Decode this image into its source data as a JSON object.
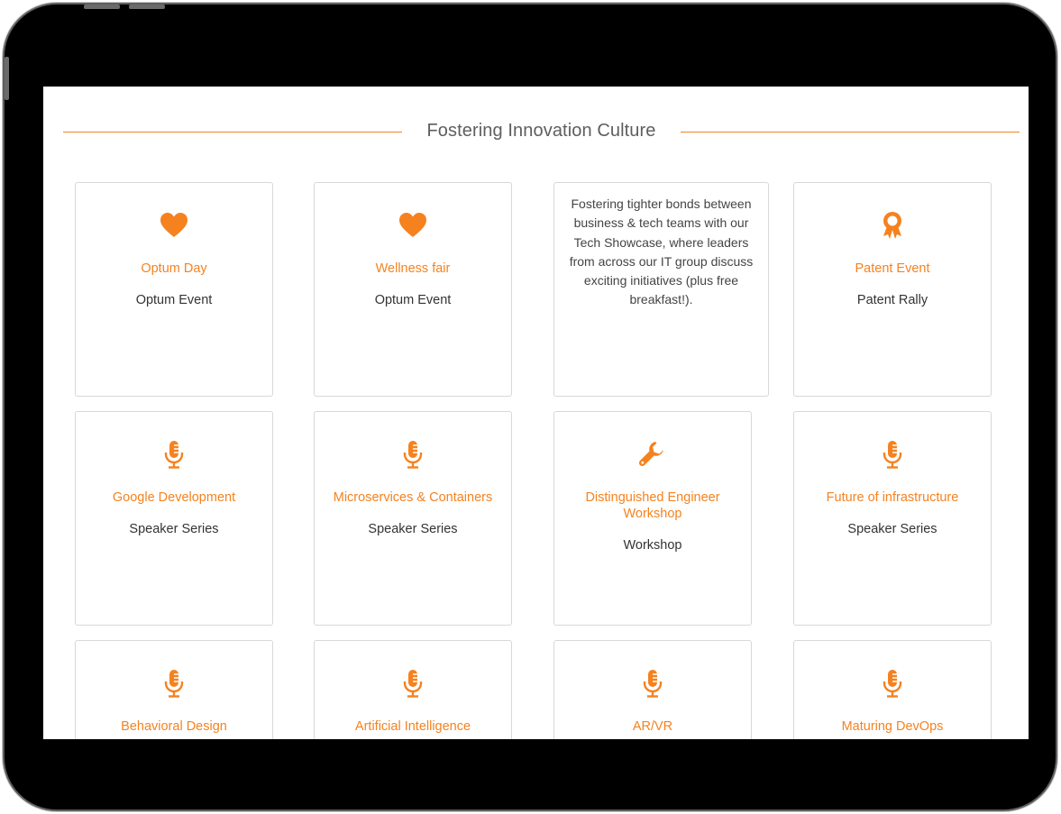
{
  "section": {
    "title": "Fostering Innovation Culture"
  },
  "accent_color": "#f5821f",
  "cards": [
    {
      "icon": "heart-icon",
      "title": "Optum Day",
      "subtitle": "Optum Event"
    },
    {
      "icon": "heart-icon",
      "title": "Wellness fair",
      "subtitle": "Optum Event"
    },
    {
      "description": "Fostering tighter bonds between business & tech teams with our Tech Showcase, where leaders from across our IT group discuss exciting initiatives (plus free breakfast!)."
    },
    {
      "icon": "award-icon",
      "title": "Patent Event",
      "subtitle": "Patent Rally"
    },
    {
      "icon": "microphone-icon",
      "title": "Google Development",
      "subtitle": "Speaker Series"
    },
    {
      "icon": "microphone-icon",
      "title": "Microservices & Containers",
      "subtitle": "Speaker Series"
    },
    {
      "icon": "wrench-icon",
      "title": "Distinguished Engineer Workshop",
      "subtitle": "Workshop"
    },
    {
      "icon": "microphone-icon",
      "title": "Future of infrastructure",
      "subtitle": "Speaker Series"
    },
    {
      "icon": "microphone-icon",
      "title": "Behavioral Design",
      "subtitle": ""
    },
    {
      "icon": "microphone-icon",
      "title": "Artificial Intelligence",
      "subtitle": ""
    },
    {
      "icon": "microphone-icon",
      "title": "AR/VR",
      "subtitle": ""
    },
    {
      "icon": "microphone-icon",
      "title": "Maturing DevOps",
      "subtitle": ""
    }
  ]
}
